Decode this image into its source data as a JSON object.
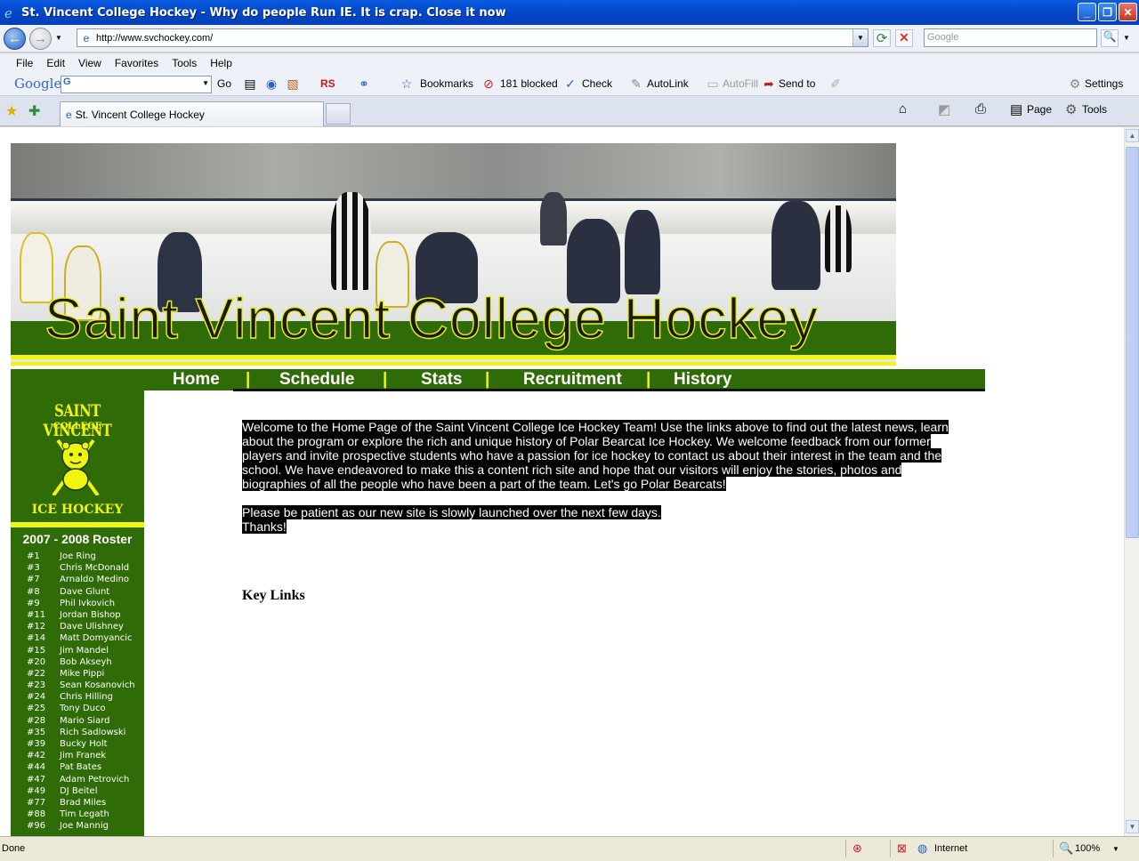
{
  "window": {
    "title": "St. Vincent College Hockey - Why do people Run IE.  It is crap. Close it now"
  },
  "address": {
    "url": "http://www.svchockey.com/",
    "search_placeholder": "Google"
  },
  "menu": [
    "File",
    "Edit",
    "View",
    "Favorites",
    "Tools",
    "Help"
  ],
  "google_toolbar": {
    "logo": "Google",
    "go": "Go",
    "rs": "RS",
    "bookmarks": "Bookmarks",
    "blocked": "181 blocked",
    "check": "Check",
    "autolink": "AutoLink",
    "autofill": "AutoFill",
    "send_to": "Send to",
    "settings": "Settings"
  },
  "tabs": {
    "active": "St. Vincent College Hockey"
  },
  "command_bar": {
    "page": "Page",
    "tools": "Tools"
  },
  "page": {
    "banner_title": "Saint Vincent College Hockey",
    "nav": [
      "Home",
      "Schedule",
      "Stats",
      "Recruitment",
      "History"
    ],
    "nav_separator": "|",
    "logo": {
      "title": "SAINT VINCENT",
      "subtitle": "COLLEGE",
      "footer": "ICE HOCKEY"
    },
    "roster_title": "2007 - 2008 Roster",
    "roster": [
      {
        "num": "#1",
        "name": "Joe Ring"
      },
      {
        "num": "#3",
        "name": "Chris McDonald"
      },
      {
        "num": "#7",
        "name": "Arnaldo Medino"
      },
      {
        "num": "#8",
        "name": "Dave Glunt"
      },
      {
        "num": "#9",
        "name": "Phil Ivkovich"
      },
      {
        "num": "#11",
        "name": "Jordan Bishop"
      },
      {
        "num": "#12",
        "name": "Dave Ulishney"
      },
      {
        "num": "#14",
        "name": "Matt Domyancic"
      },
      {
        "num": "#15",
        "name": "Jim Mandel"
      },
      {
        "num": "#20",
        "name": "Bob Akseyh"
      },
      {
        "num": "#22",
        "name": "Mike Pippi"
      },
      {
        "num": "#23",
        "name": "Sean Kosanovich"
      },
      {
        "num": "#24",
        "name": "Chris Hilling"
      },
      {
        "num": "#25",
        "name": "Tony Duco"
      },
      {
        "num": "#28",
        "name": "Mario Siard"
      },
      {
        "num": "#35",
        "name": "Rich Sadlowski"
      },
      {
        "num": "#39",
        "name": "Bucky Holt"
      },
      {
        "num": "#42",
        "name": "Jim Franek"
      },
      {
        "num": "#44",
        "name": "Pat Bates"
      },
      {
        "num": "#47",
        "name": "Adam Petrovich"
      },
      {
        "num": "#49",
        "name": "DJ Beitel"
      },
      {
        "num": "#77",
        "name": "Brad Miles"
      },
      {
        "num": "#88",
        "name": "Tim Legath"
      },
      {
        "num": "#96",
        "name": "Joe Mannig"
      }
    ],
    "welcome_lines": [
      "Welcome to the Home Page of the Saint Vincent College Ice Hockey Team!  Use the links above to find out the latest news, learn",
      "about the program or explore the rich and unique history of Polar Bearcat Ice Hockey.  We welcome feedback from our former",
      "players and invite prospective students who have a passion for ice hockey to contact us about their interest in the team and the",
      "school. We have endeavored to make this a content rich site and hope that our visitors will enjoy the stories, photos and",
      "biographies of all the people who have been a part of the team.  Let's go Polar Bearcats!"
    ],
    "notice_lines": [
      "Please be patient as our new site is slowly launched over the next few days.",
      "Thanks!"
    ],
    "key_links": "Key Links"
  },
  "status": {
    "text": "Done",
    "zone": "Internet",
    "zoom": "100%"
  },
  "colors": {
    "green": "#2f6b06",
    "yellow": "#f1f40f"
  }
}
